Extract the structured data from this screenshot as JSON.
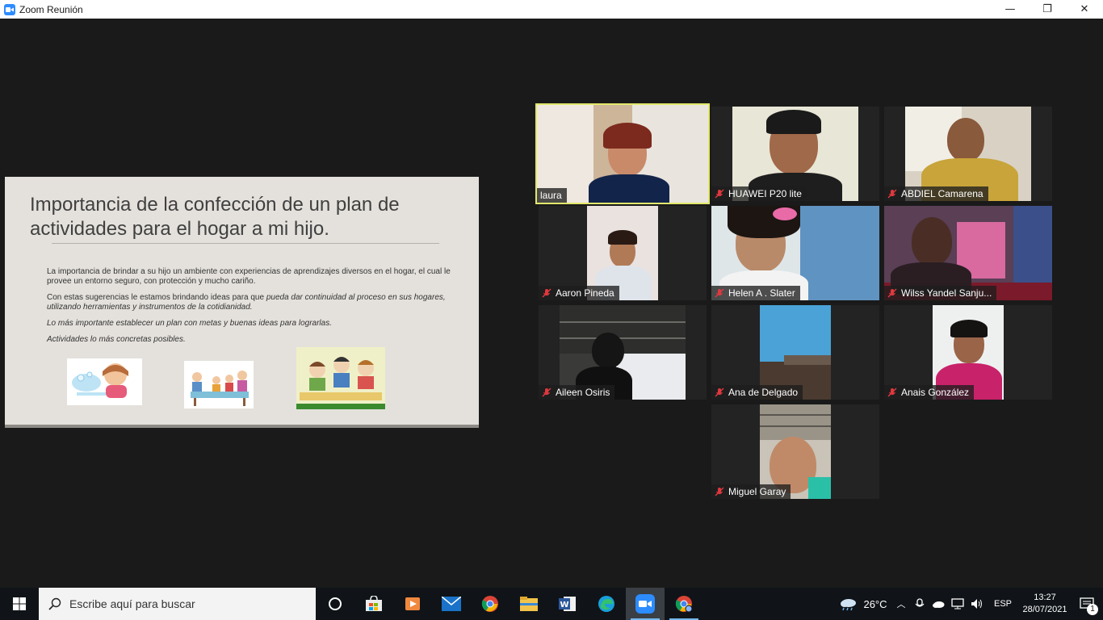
{
  "window": {
    "title": "Zoom Reunión",
    "minimize": "—",
    "maximize": "❐",
    "close": "✕"
  },
  "slide": {
    "title": "Importancia de la confección de un plan de actividades para el hogar a mi hijo.",
    "paragraph1": "La importancia de brindar a  su hijo un ambiente con experiencias de aprendizajes diversos en el hogar, el cual le provee un  entorno seguro, con protección y mucho cariño.",
    "paragraph2_normal": "Con estas sugerencias le estamos brindando ideas para que ",
    "paragraph2_italic": "pueda dar continuidad al proceso en sus hogares, utilizando herramientas y instrumentos de la cotidianidad.",
    "paragraph3": "Lo más importante establecer un plan con metas y buenas ideas para lograrlas.",
    "paragraph4": "Actividades lo más concretas posibles."
  },
  "participants": [
    {
      "name": "laura",
      "muted": false,
      "active_speaker": true
    },
    {
      "name": "HUAWEI P20 lite",
      "muted": true
    },
    {
      "name": "ABDIEL Camarena",
      "muted": true
    },
    {
      "name": "Aaron Pineda",
      "muted": true
    },
    {
      "name": "Helen A . Slater",
      "muted": true
    },
    {
      "name": "Wilss Yandel Sanju...",
      "muted": true
    },
    {
      "name": "Aileen Osiris",
      "muted": true
    },
    {
      "name": "Ana de Delgado",
      "muted": true
    },
    {
      "name": "Anais González",
      "muted": true
    },
    {
      "name": "Miguel Garay",
      "muted": true
    }
  ],
  "taskbar": {
    "search_placeholder": "Escribe aquí para buscar",
    "weather": "26°C",
    "language": "ESP",
    "time": "13:27",
    "date": "28/07/2021",
    "notification_count": "1",
    "apps": [
      "cortana-icon",
      "store-icon",
      "media-player-icon",
      "mail-icon",
      "chrome-icon",
      "file-explorer-icon",
      "word-icon",
      "edge-icon",
      "zoom-icon",
      "chrome-profile-icon"
    ]
  },
  "colors": {
    "active_speaker_outline": "#e2e86b",
    "muted_red": "#e0383e",
    "zoom_blue": "#2d8cff",
    "taskbar_bg": "#101418"
  }
}
